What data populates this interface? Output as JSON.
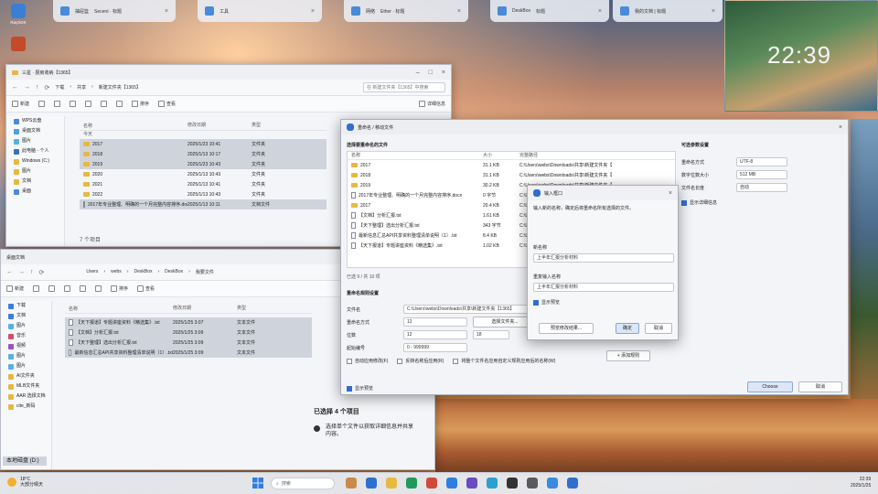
{
  "desktop": {
    "icons": [
      {
        "label": "RaySDK",
        "color": "#3a7fd6"
      },
      {
        "label": "",
        "color": "#c44a2a"
      }
    ],
    "clock": "22:39"
  },
  "task_tiles": [
    {
      "label": "抽屉篮",
      "detail": "Secent · 标题"
    },
    {
      "label": "工具",
      "detail": ""
    },
    {
      "label": "网络",
      "detail": "Ether · 标题"
    },
    {
      "label": "DeskBox",
      "detail": "标题"
    },
    {
      "label": "我的文档 | 标题",
      "detail": ""
    }
  ],
  "explorer_top": {
    "title": "三星 · 厨房收纳【1365】",
    "path": [
      "下载",
      "共享",
      "新建文件夹【1365】"
    ],
    "search_placeholder": "在 新建文件夹【1365】中搜索",
    "toolbar": [
      "新建",
      "剪切",
      "复制",
      "粘贴",
      "重命名",
      "共享",
      "删除",
      "排序",
      "查看",
      "详细信息"
    ],
    "sidebar": [
      "WPS云盘",
      "桌面文档",
      "图片",
      "此电脑 - 个人",
      "Windows (C:)",
      "图片",
      "文档",
      "桌面"
    ],
    "headers": [
      "名称",
      "修改日期",
      "类型"
    ],
    "group_label": "今天",
    "files": [
      {
        "name": "2017",
        "date": "2025/1/23 10:41",
        "type": "文件夹",
        "icon": "folder",
        "selected": true
      },
      {
        "name": "2018",
        "date": "2025/1/13 10:17",
        "type": "文件夹",
        "icon": "folder",
        "selected": true
      },
      {
        "name": "2019",
        "date": "2025/1/23 10:43",
        "type": "文件夹",
        "icon": "folder",
        "selected": true
      },
      {
        "name": "2020",
        "date": "2025/1/13 10:43",
        "type": "文件夹",
        "icon": "folder",
        "selected": false
      },
      {
        "name": "2021",
        "date": "2025/1/13 10:41",
        "type": "文件夹",
        "icon": "folder",
        "selected": false
      },
      {
        "name": "2022",
        "date": "2025/1/13 10:43",
        "type": "文件夹",
        "icon": "folder",
        "selected": false
      },
      {
        "name": "2017年专业整理、明确的一个月完整内容排序.docx",
        "date": "2025/1/13 10:11",
        "type": "文档文件",
        "icon": "doc",
        "selected": true
      }
    ],
    "status": "7 个项目"
  },
  "explorer_bottom": {
    "title": "桌面文档",
    "path": [
      "Users",
      "webs",
      "DeskBox",
      "DeskBox",
      "我要文件"
    ],
    "sidebar": [
      "下载",
      "文档",
      "图片",
      "音乐",
      "视频",
      "图片",
      "图片",
      "AI文件夹",
      "MLB文件夹",
      "AAR 选择文档",
      "cite_新码"
    ],
    "bottom_drive": "本地磁盘 (D:)",
    "headers": [
      "名称",
      "修改日期",
      "类型"
    ],
    "files": [
      {
        "name": "【天下报道】专题讲座资料《精选集》.txt",
        "date": "2025/1/25 3:07",
        "type": "文本文件"
      },
      {
        "name": "【文档】分析汇报.txt",
        "date": "2025/1/25 3:09",
        "type": "文本文件"
      },
      {
        "name": "【天下整理】选出分析汇报.txt",
        "date": "2025/1/25 3:09",
        "type": "文本文件"
      },
      {
        "name": "最新信息汇总API共享资料整理清单说明（1）.txt",
        "date": "2025/1/25 3:09",
        "type": "文本文件"
      }
    ],
    "details_title": "已选择 4 个项目",
    "details_text": "选择单个文件以获取详细信息并共享内容。"
  },
  "rename_dialog": {
    "title": "重命名 / 移动文件",
    "section1": "选择要重命名的文件",
    "headers": [
      "名称",
      "大小",
      "完整路径"
    ],
    "files": [
      {
        "name": "2017",
        "size": "31.1 KB",
        "path": "C:\\Users\\webs\\Downloads\\共享\\新建文件夹【"
      },
      {
        "name": "2018",
        "size": "31.1 KB",
        "path": "C:\\Users\\webs\\Downloads\\共享\\新建文件夹【"
      },
      {
        "name": "2019",
        "size": "30.2 KB",
        "path": "C:\\Users\\webs\\Downloads\\共享\\新建文件夹【"
      },
      {
        "name": "2017年专业整理、明确的一个月完整内容排序.docx",
        "size": "0 字节",
        "path": "C:\\Users\\webs\\Downloads\\共享\\新建文件夹【"
      },
      {
        "name": "2017",
        "size": "20.4 KB",
        "path": "C:\\Users\\webs\\Downloads\\共享\\新建文件夹【"
      },
      {
        "name": "【文档】分析汇报.txt",
        "size": "1.61 KB",
        "path": "C:\\Users\\webs\\Downloads\\共享\\新建文件夹【"
      },
      {
        "name": "【天下整理】选出分析汇报.txt",
        "size": "343 字节",
        "path": "C:\\Users\\webs\\Downloads\\共享\\新建文件夹【"
      },
      {
        "name": "最新信息汇总API共享资料整理清单说明（1）.txt",
        "size": "8.4 KB",
        "path": "C:\\Users\\webs\\Downloads\\共享\\新建文件夹【"
      },
      {
        "name": "【天下报道】专题讲座资料《精选集》.txt",
        "size": "1.02 KB",
        "path": "C:\\Users\\webs\\Downloads\\共享\\新建文件夹【"
      }
    ],
    "count_label": "已选 9 / 共 10 项",
    "section2": "重命名规则设置",
    "rows": [
      {
        "label": "文件名",
        "value": "C:\\Users\\webs\\Downloads\\共享\\新建文件夹【1365】"
      },
      {
        "label": "重命名方式",
        "value": "12"
      },
      {
        "label": "位数",
        "value": "12"
      },
      {
        "label": "起始编号",
        "value": "0 - 999999"
      }
    ],
    "browse_label": "选择文件夹...",
    "stepper_value": "18",
    "apply_label": "+ 添加规则",
    "options": [
      "自动应用修改(F)",
      "反转名称后应用(R)",
      "将整个文件名应用自定义规则应用后的名称(W)"
    ],
    "preview_label": "显示预览",
    "right_title": "可选参数设置",
    "right_rows": [
      {
        "label": "重命名方式",
        "value": "UTF-8"
      },
      {
        "label": "数字位数大小",
        "value": "512 MB"
      },
      {
        "label": "文件名长度",
        "value": "自动"
      }
    ],
    "right_check": "显示详细信息",
    "ok": "Choose",
    "cancel": "取消"
  },
  "input_dialog": {
    "title": "输入框口",
    "desc": "输入新的名称，确定后将重命名所有选择的文件。",
    "label1": "新名称",
    "value1": "上半年汇报分析材料",
    "label2": "重复输入名称",
    "value2": "上半年汇报分析材料",
    "check": "显示预览",
    "btn_preview": "预览修改结果...",
    "btn_ok": "确定",
    "btn_cancel": "取消"
  },
  "taskbar": {
    "weather_temp": "18°C",
    "weather_desc": "大部分晴天",
    "search_placeholder": "搜索",
    "time": "22:39",
    "date": "2025/1/25"
  }
}
